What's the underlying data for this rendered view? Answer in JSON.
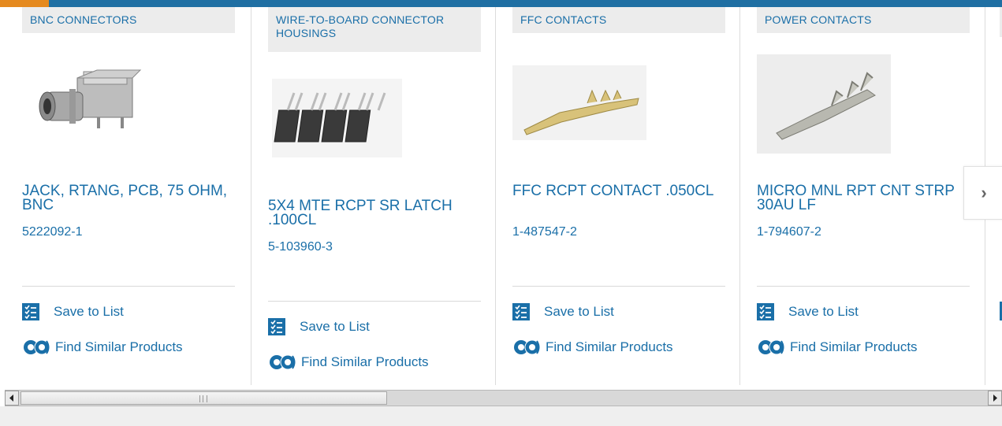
{
  "cards": [
    {
      "category": "BNC CONNECTORS",
      "title": "JACK, RTANG, PCB, 75 OHM, BNC",
      "part_number": "5222092-1",
      "image_icon": "bnc-connector-image",
      "save_label": "Save to List",
      "similar_label": "Find Similar Products"
    },
    {
      "category": "WIRE-TO-BOARD CONNECTOR HOUSINGS",
      "title": "5X4 MTE RCPT SR LATCH .100CL",
      "part_number": "5-103960-3",
      "image_icon": "connector-housing-image",
      "save_label": "Save to List",
      "similar_label": "Find Similar Products"
    },
    {
      "category": "FFC CONTACTS",
      "title": "FFC RCPT CONTACT .050CL",
      "part_number": "1-487547-2",
      "image_icon": "ffc-contact-image",
      "save_label": "Save to List",
      "similar_label": "Find Similar Products"
    },
    {
      "category": "POWER CONTACTS",
      "title": "MICRO MNL RPT CNT STRP 30AU LF",
      "part_number": "1-794607-2",
      "image_icon": "power-contact-image",
      "save_label": "Save to List",
      "similar_label": "Find Similar Products"
    }
  ],
  "next_button_icon": "chevron-right-icon",
  "next_glyph": "›",
  "colors": {
    "link": "#1a6fa8",
    "top_bar": "#1f6fa3",
    "top_accent": "#e58a1f"
  }
}
